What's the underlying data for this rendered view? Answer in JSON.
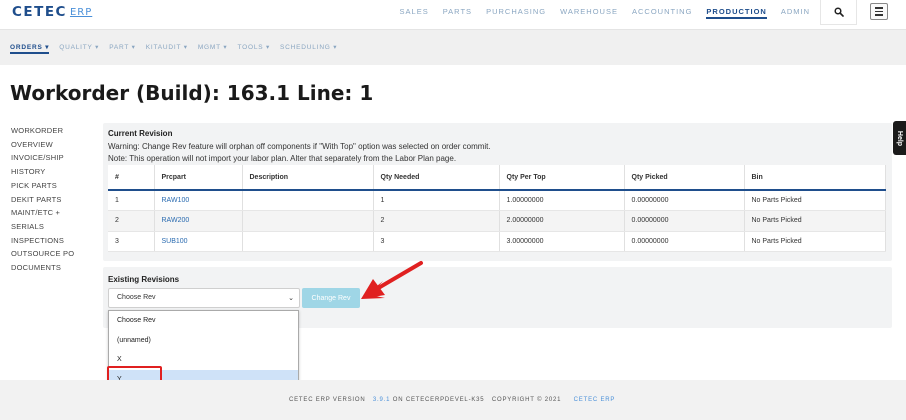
{
  "app": {
    "logo": "CETEC",
    "logo_suffix": "ERP"
  },
  "main_nav": [
    "SALES",
    "PARTS",
    "PURCHASING",
    "WAREHOUSE",
    "ACCOUNTING",
    "PRODUCTION",
    "ADMIN"
  ],
  "main_nav_active": "PRODUCTION",
  "sub_nav": [
    "ORDERS ▾",
    "QUALITY ▾",
    "PART ▾",
    "KITAUDIT ▾",
    "MGMT ▾",
    "TOOLS ▾",
    "SCHEDULING ▾"
  ],
  "sub_nav_active": "ORDERS ▾",
  "page_title": "Workorder (Build): 163.1 Line: 1",
  "side_menu": [
    "WORKORDER",
    "OVERVIEW",
    "INVOICE/SHIP",
    "HISTORY",
    "PICK PARTS",
    "DEKIT PARTS",
    "MAINT/ETC +",
    "SERIALS",
    "INSPECTIONS",
    "OUTSOURCE PO",
    "DOCUMENTS"
  ],
  "help_tab": "Help",
  "current_revision": {
    "title": "Current Revision",
    "warning": "Warning: Change Rev feature will orphan off components if \"With Top\" option was selected on order commit.",
    "note": "Note: This operation will not import your labor plan. Alter that separately from the Labor Plan page.",
    "columns": [
      "#",
      "Prcpart",
      "Description",
      "Qty Needed",
      "Qty Per Top",
      "Qty Picked",
      "Bin"
    ],
    "rows": [
      [
        "1",
        "RAW100",
        "",
        "1",
        "1.00000000",
        "0.00000000",
        "No Parts Picked"
      ],
      [
        "2",
        "RAW200",
        "",
        "2",
        "2.00000000",
        "0.00000000",
        "No Parts Picked"
      ],
      [
        "3",
        "SUB100",
        "",
        "3",
        "3.00000000",
        "0.00000000",
        "No Parts Picked"
      ]
    ]
  },
  "existing_revisions": {
    "title": "Existing Revisions",
    "selected": "Choose Rev",
    "change_button": "Change Rev",
    "options": [
      "Choose Rev",
      "(unnamed)",
      "X",
      "Y"
    ],
    "highlighted_option": "Y"
  },
  "footer": {
    "label": "CETEC ERP VERSION",
    "version": "3.9.1",
    "host": "ON CETECERPDEVEL-K35",
    "copyright": "COPYRIGHT © 2021",
    "brand": "CETEC ERP"
  },
  "colors": {
    "brand_navy": "#1f4e8c",
    "link_blue": "#2a6bb0",
    "button_disabled": "#9fd6e6",
    "annotation_red": "#e02020",
    "option_highlight": "#cfe2f8"
  }
}
